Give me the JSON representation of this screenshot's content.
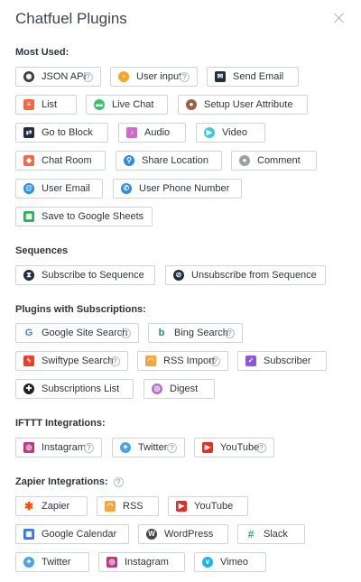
{
  "header": {
    "title": "Chatfuel Plugins"
  },
  "sections": {
    "most_used": "Most Used:",
    "sequences": "Sequences",
    "subscriptions": "Plugins with Subscriptions:",
    "ifttt": "IFTTT Integrations:",
    "zapier": "Zapier Integrations:"
  },
  "plugins": {
    "json_api": "JSON API",
    "user_input": "User input",
    "send_email": "Send Email",
    "list": "List",
    "live_chat": "Live Chat",
    "setup_user_attribute": "Setup User Attribute",
    "go_to_block": "Go to Block",
    "audio": "Audio",
    "video": "Video",
    "chat_room": "Chat Room",
    "share_location": "Share Location",
    "comment": "Comment",
    "user_email": "User Email",
    "user_phone_number": "User Phone Number",
    "save_to_google_sheets": "Save to Google Sheets",
    "subscribe_to_sequence": "Subscribe to Sequence",
    "unsubscribe_from_sequence": "Unsubscribe from Sequence",
    "google_site_search": "Google Site Search",
    "bing_search": "Bing Search",
    "swiftype_search": "Swiftype Search",
    "rss_import": "RSS Import",
    "subscriber": "Subscriber",
    "subscriptions_list": "Subscriptions List",
    "digest": "Digest",
    "ifttt_instagram": "Instagram",
    "ifttt_twitter": "Twitter",
    "ifttt_youtube": "YouTube",
    "zapier": "Zapier",
    "zapier_rss": "RSS",
    "zapier_youtube": "YouTube",
    "google_calendar": "Google Calendar",
    "wordpress": "WordPress",
    "slack": "Slack",
    "zapier_twitter": "Twitter",
    "zapier_instagram": "Instagram",
    "vimeo": "Vimeo"
  },
  "help_glyph": "?",
  "colors": {
    "json_api": "#3a3a3a",
    "user_input": "#f5a623",
    "send_email": "#1f2d3d",
    "list": "#f06a4a",
    "live_chat": "#3bc16d",
    "setup_user_attribute": "#9a5f45",
    "go_to_block": "#1f2d3d",
    "audio": "#d268c9",
    "video": "#41c9d6",
    "chat_room": "#f06a4a",
    "share_location": "#2c8be6",
    "comment": "#9aa0a6",
    "user_email": "#2c8be6",
    "user_phone_number": "#2c8be6",
    "save_to_google_sheets": "#2eae5a",
    "sequence": "#1f2d3d",
    "google": "#4285f4",
    "bing": "#138b87",
    "swiftype": "#e8432a",
    "rss": "#f6a43b",
    "subscriber": "#8e56d9",
    "subscriptions_list": "#222222",
    "digest": "#b06fd8",
    "instagram": "#c13584",
    "twitter": "#4aa3e8",
    "youtube": "#e52d27",
    "zapier": "#ff4a00",
    "google_calendar": "#3a74e0",
    "wordpress": "#464646",
    "slack": "#3aa57b",
    "vimeo": "#1ab7ea"
  }
}
